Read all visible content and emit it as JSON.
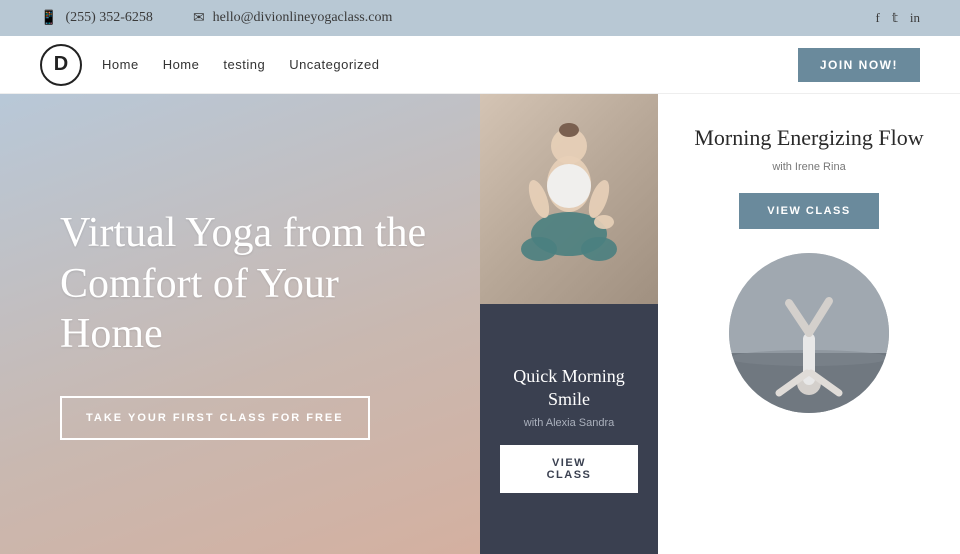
{
  "topbar": {
    "phone": "(255) 352-6258",
    "email": "hello@divionlineyogaclass.com",
    "phone_icon": "📱",
    "email_icon": "✉",
    "socials": [
      "f",
      "𝕥",
      "in"
    ]
  },
  "nav": {
    "logo_letter": "D",
    "links": [
      "Home",
      "Home",
      "testing",
      "Uncategorized"
    ],
    "cta_label": "Join Now!"
  },
  "hero": {
    "title": "Virtual Yoga from the Comfort of Your Home",
    "cta_label": "Take Your First Class For Free"
  },
  "card_top_right": {
    "title": "Morning Energizing Flow",
    "instructor": "with Irene Rina",
    "button_label": "View Class"
  },
  "card_dark": {
    "title": "Quick Morning Smile",
    "instructor": "with Alexia Sandra",
    "button_label": "View Class"
  }
}
